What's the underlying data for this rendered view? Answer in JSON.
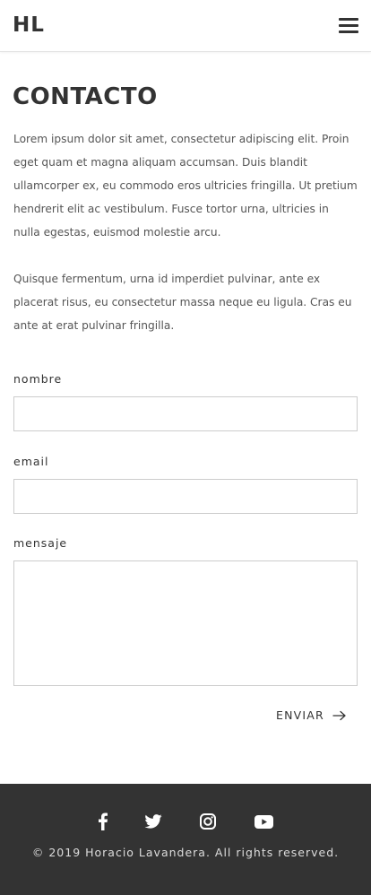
{
  "header": {
    "logo": "HL",
    "menu_icon": "hamburger-menu-icon"
  },
  "main": {
    "title": "CONTACTO",
    "paragraphs": [
      "Lorem ipsum dolor sit amet, consectetur adipiscing elit. Proin eget quam et magna aliquam accumsan. Duis blandit ullamcorper ex, eu commodo eros ultricies fringilla. Ut pretium hendrerit elit ac vestibulum. Fusce tortor urna, ultricies in nulla egestas, euismod molestie arcu.",
      "Quisque fermentum, urna id imperdiet pulvinar, ante ex placerat risus, eu consectetur massa neque eu ligula. Cras eu ante at erat pulvinar fringilla."
    ]
  },
  "form": {
    "name_label": "nombre",
    "name_value": "",
    "email_label": "email",
    "email_value": "",
    "message_label": "mensaje",
    "message_value": "",
    "submit_label": "ENVIAR",
    "submit_icon": "arrow-right-icon"
  },
  "footer": {
    "social_icons": [
      "facebook-icon",
      "twitter-icon",
      "instagram-icon",
      "youtube-icon"
    ],
    "copyright": "© 2019 Horacio Lavandera. All rights reserved."
  },
  "colors": {
    "text": "#333333",
    "body_text": "#555555",
    "footer_bg": "#333333",
    "border": "#cccccc",
    "footer_text": "#dddddd"
  }
}
